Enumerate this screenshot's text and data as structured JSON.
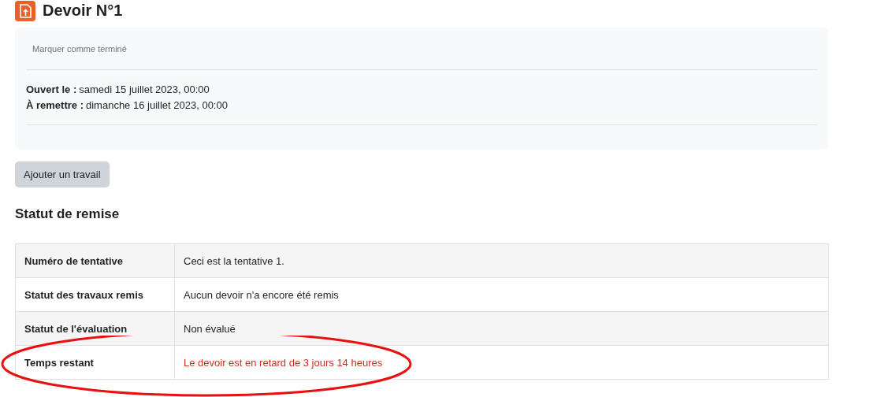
{
  "title": "Devoir N°1",
  "activity": {
    "completion_button": "Marquer comme terminé",
    "dates": [
      {
        "label": "Ouvert le :",
        "value": "samedi 15 juillet 2023, 00:00"
      },
      {
        "label": "À remettre :",
        "value": "dimanche 16 juillet 2023, 00:00"
      }
    ]
  },
  "add_button": "Ajouter un travail",
  "section_heading": "Statut de remise",
  "status_rows": [
    {
      "label": "Numéro de tentative",
      "value": "Ceci est la tentative 1.",
      "kind": "plain",
      "circled": false
    },
    {
      "label": "Statut des travaux remis",
      "value": "Aucun devoir n'a encore été remis",
      "kind": "plain",
      "circled": false
    },
    {
      "label": "Statut de l'évaluation",
      "value": "Non évalué",
      "kind": "plain",
      "circled": false
    },
    {
      "label": "Temps restant",
      "value": "Le devoir est en retard de 3 jours 14 heures",
      "kind": "overdue",
      "circled": true
    }
  ]
}
